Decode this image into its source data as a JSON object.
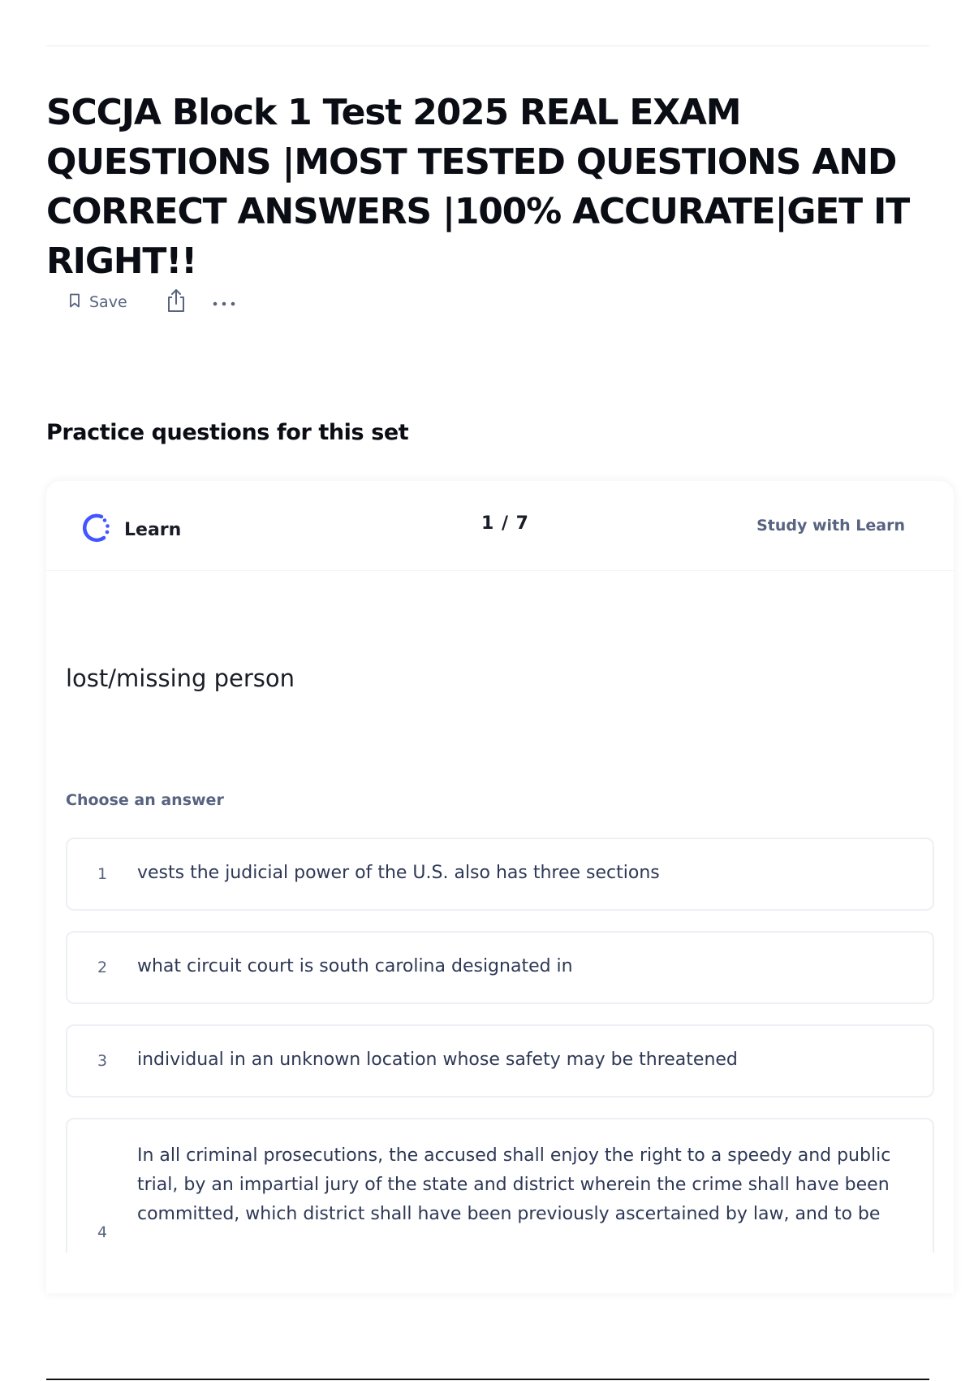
{
  "page": {
    "title": "SCCJA Block 1 Test 2025 REAL EXAM QUESTIONS |MOST TESTED QUESTIONS AND CORRECT ANSWERS |100% ACCURATE|GET IT RIGHT!!"
  },
  "actions": {
    "save_label": "Save",
    "save_icon": "bookmark-icon",
    "share_icon": "share-icon",
    "more_icon": "more-icon"
  },
  "practice": {
    "heading": "Practice questions for this set",
    "learn_label": "Learn",
    "learn_icon": "learn-mode-icon",
    "progress": "1 / 7",
    "study_link": "Study with Learn",
    "prompt": "lost/missing person",
    "choose_label": "Choose an answer",
    "answers": [
      {
        "number": "1",
        "text": "vests the judicial power of the U.S. also has three sections"
      },
      {
        "number": "2",
        "text": "what circuit court is south carolina designated in"
      },
      {
        "number": "3",
        "text": "individual in an unknown location whose safety may be threatened"
      },
      {
        "number": "4",
        "text": "In all criminal prosecutions, the accused shall enjoy the right to a speedy and public trial, by an impartial jury of the state and district wherein the crime shall have been committed, which district shall have been previously ascertained by law, and to be"
      }
    ]
  },
  "colors": {
    "accent": "#4255ff",
    "muted_text": "#586380",
    "body_text": "#2e3856",
    "border": "#edeff4"
  }
}
